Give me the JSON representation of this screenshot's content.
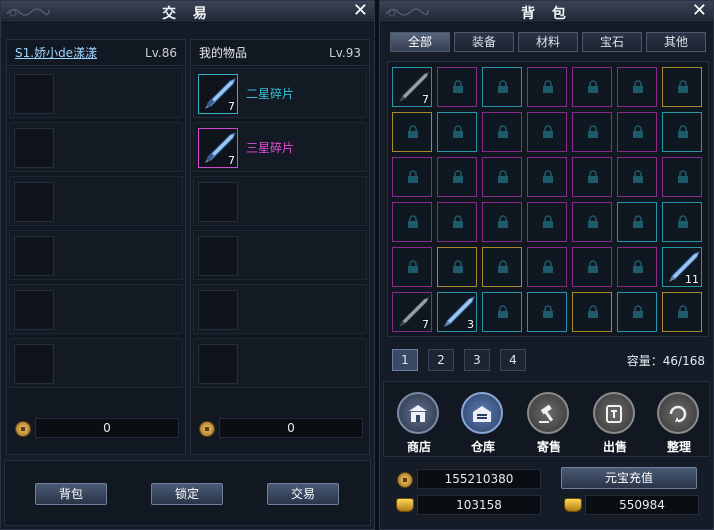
{
  "trade": {
    "title": "交 易",
    "left": {
      "name": "S1.娇小de漾漾",
      "level": "Lv.86",
      "money": "0"
    },
    "right": {
      "header": "我的物品",
      "level": "Lv.93",
      "items": [
        {
          "name": "二星碎片",
          "qty": "7",
          "color": "#35c3d6"
        },
        {
          "name": "三星碎片",
          "qty": "7",
          "color": "#e04fe0"
        }
      ],
      "money": "0"
    },
    "buttons": {
      "bag": "背包",
      "lock": "锁定",
      "trade": "交易"
    }
  },
  "bag": {
    "title": "背 包",
    "tabs": [
      "全部",
      "装备",
      "材料",
      "宝石",
      "其他"
    ],
    "active_tab": "全部",
    "item_qty": {
      "r0c0": "7",
      "r4c6": "11",
      "r5c0": "7",
      "r5c1": "3"
    },
    "pages": [
      "1",
      "2",
      "3",
      "4"
    ],
    "active_page": "1",
    "capacity": "容量：46/168",
    "actions": [
      "商店",
      "仓库",
      "寄售",
      "出售",
      "整理"
    ],
    "recharge_label": "元宝充值",
    "copper": "155210380",
    "gold_bound": "103158",
    "yuanbao": "550984"
  },
  "colors": {
    "cyan": "#2596a8",
    "pink": "#8a2a8a",
    "gold": "#a98a2b",
    "accent": "#9fd3ff"
  }
}
